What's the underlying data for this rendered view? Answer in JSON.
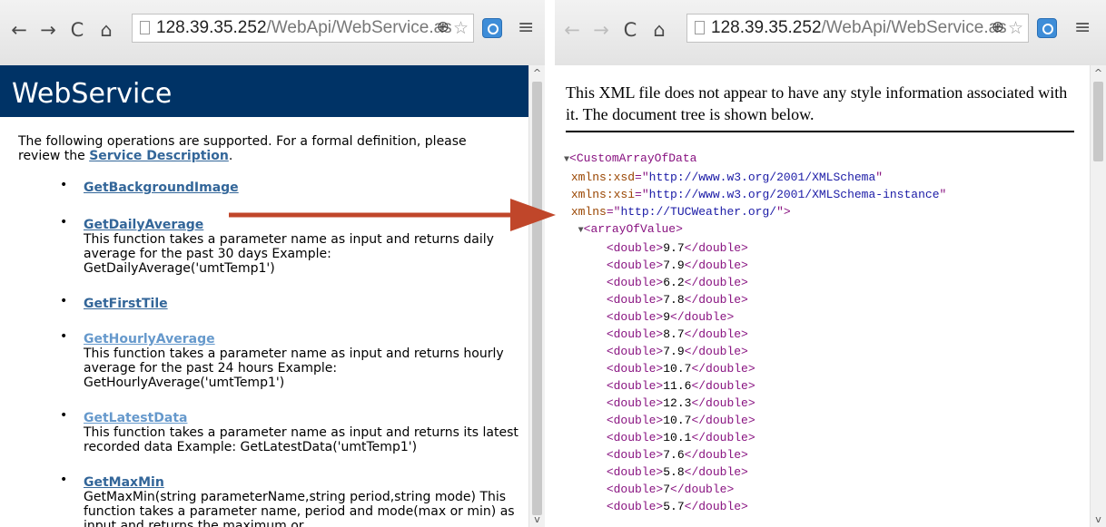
{
  "left": {
    "url_host": "128.39.35.252",
    "url_path": "/WebApi/WebService.as",
    "page_title": "WebService",
    "intro_text": "The following operations are supported. For a formal definition, please review the",
    "intro_link": "Service Description",
    "intro_end": ".",
    "operations": [
      {
        "name": "GetBackgroundImage",
        "desc": ""
      },
      {
        "name": "GetDailyAverage",
        "desc": "This function takes a parameter name as input and returns daily average for the past 30 days Example: GetDailyAverage('umtTemp1')"
      },
      {
        "name": "GetFirstTile",
        "desc": ""
      },
      {
        "name": "GetHourlyAverage",
        "desc": "This function takes a parameter name as input and returns hourly average for the past 24 hours Example: GetHourlyAverage('umtTemp1')"
      },
      {
        "name": "GetLatestData",
        "desc": "This function takes a parameter name as input and returns its latest recorded data Example: GetLatestData('umtTemp1')"
      },
      {
        "name": "GetMaxMin",
        "desc": "GetMaxMin(string parameterName,string period,string mode) This function takes a parameter name, period and mode(max or min) as input and returns the maximum or"
      }
    ]
  },
  "right": {
    "url_host": "128.39.35.252",
    "url_path": "/WebApi/WebService.as",
    "notice": "This XML file does not appear to have any style information associated with it. The document tree is shown below.",
    "root_tag": "CustomArrayOfData",
    "attributes": [
      {
        "name": "xmlns:xsd",
        "value": "http://www.w3.org/2001/XMLSchema"
      },
      {
        "name": "xmlns:xsi",
        "value": "http://www.w3.org/2001/XMLSchema-instance"
      },
      {
        "name": "xmlns",
        "value": "http://TUCWeather.org/"
      }
    ],
    "array_tag": "arrayOfValue",
    "value_tag": "double",
    "values": [
      "9.7",
      "7.9",
      "6.2",
      "7.8",
      "9",
      "8.7",
      "7.9",
      "10.7",
      "11.6",
      "12.3",
      "10.7",
      "10.1",
      "7.6",
      "5.8",
      "7",
      "5.7"
    ]
  },
  "icons": {
    "back": "back-arrow-icon",
    "forward": "forward-arrow-icon",
    "reload": "reload-icon",
    "home": "home-icon",
    "zoom": "zoom-icon",
    "star": "star-icon",
    "extension": "extension-icon",
    "menu": "menu-icon"
  },
  "colors": {
    "header_bg": "#003366",
    "link": "#336699",
    "arrow": "#c0462a",
    "xml_tag": "#881280",
    "xml_attr": "#994500",
    "xml_value": "#1a1aa6"
  }
}
